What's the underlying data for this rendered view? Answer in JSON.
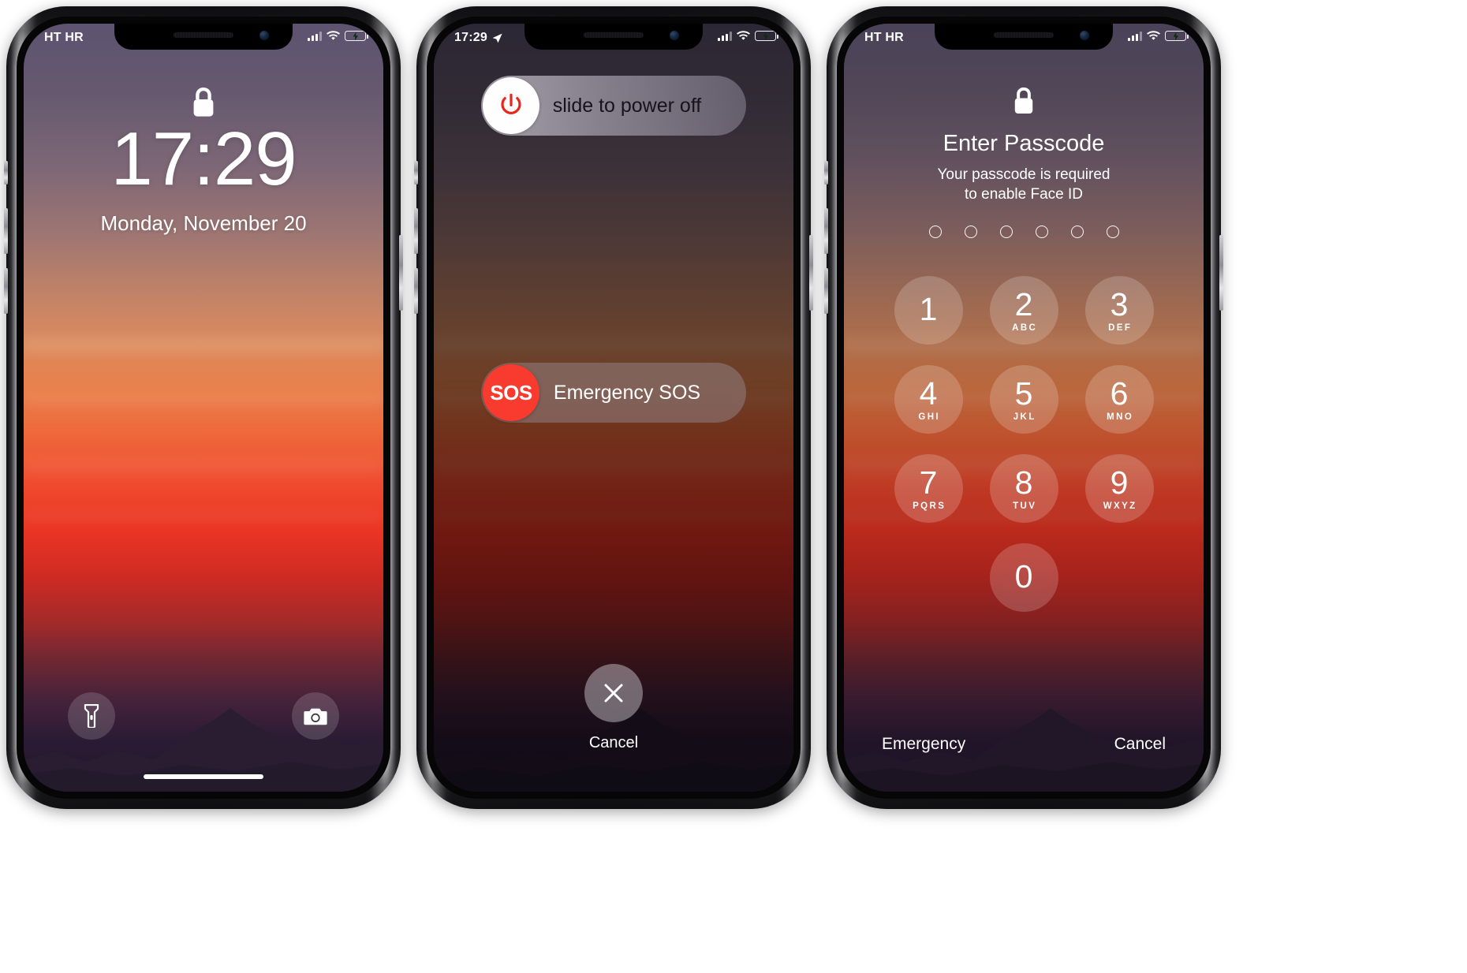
{
  "colors": {
    "sos_red": "#f93a2f",
    "power_red": "#e8261c",
    "battery_green": "#4cd964",
    "accent_white": "#ffffff"
  },
  "phones": [
    {
      "id": "lock-screen",
      "status_bar": {
        "carrier": "HT HR",
        "signal_icon": "cellular-bars-icon",
        "wifi_icon": "wifi-icon",
        "battery_icon": "battery-charging-icon"
      },
      "lock_icon": "lock-closed-icon",
      "time": "17:29",
      "date": "Monday, November 20",
      "shortcuts": [
        {
          "name": "flashlight",
          "icon": "flashlight-icon"
        },
        {
          "name": "camera",
          "icon": "camera-icon"
        }
      ],
      "home_indicator": "home-indicator"
    },
    {
      "id": "power-off-screen",
      "status_bar": {
        "time": "17:29",
        "location_icon": "location-arrow-icon",
        "signal_icon": "cellular-bars-icon",
        "wifi_icon": "wifi-icon",
        "battery_icon": "battery-charging-icon"
      },
      "power_slider": {
        "label": "slide to power off",
        "knob_icon": "power-icon"
      },
      "sos_slider": {
        "label": "Emergency SOS",
        "knob_label": "SOS"
      },
      "cancel": {
        "label": "Cancel",
        "icon": "close-x-icon"
      }
    },
    {
      "id": "passcode-screen",
      "status_bar": {
        "carrier": "HT HR",
        "signal_icon": "cellular-bars-icon",
        "wifi_icon": "wifi-icon",
        "battery_icon": "battery-charging-icon"
      },
      "lock_icon": "lock-closed-icon",
      "title": "Enter Passcode",
      "subtitle": "Your passcode is required\nto enable Face ID",
      "subtitle_line1": "Your passcode is required",
      "subtitle_line2": "to enable Face ID",
      "passcode_dots": 6,
      "passcode_filled": 0,
      "keypad": [
        {
          "num": "1",
          "letters": ""
        },
        {
          "num": "2",
          "letters": "ABC"
        },
        {
          "num": "3",
          "letters": "DEF"
        },
        {
          "num": "4",
          "letters": "GHI"
        },
        {
          "num": "5",
          "letters": "JKL"
        },
        {
          "num": "6",
          "letters": "MNO"
        },
        {
          "num": "7",
          "letters": "PQRS"
        },
        {
          "num": "8",
          "letters": "TUV"
        },
        {
          "num": "9",
          "letters": "WXYZ"
        },
        {
          "num": "0",
          "letters": ""
        }
      ],
      "footer": {
        "emergency": "Emergency",
        "cancel": "Cancel"
      }
    }
  ]
}
